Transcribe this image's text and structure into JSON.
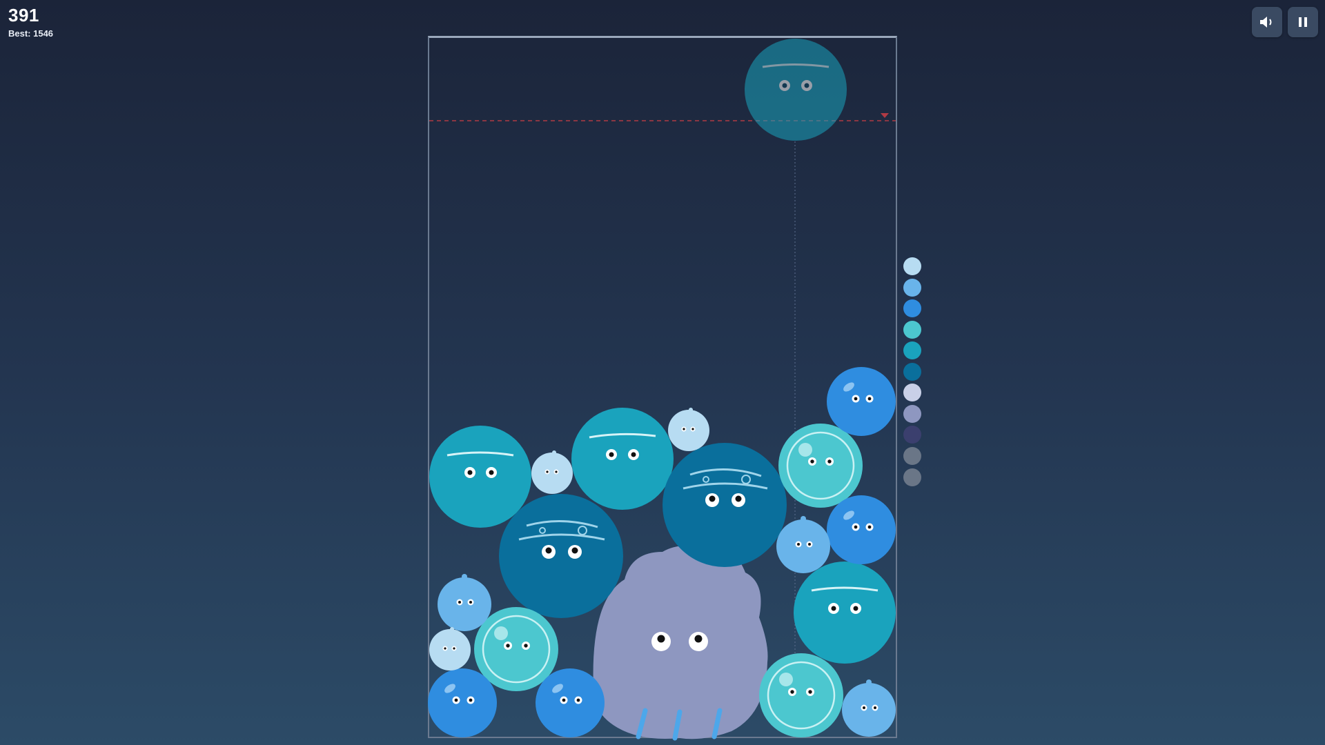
{
  "hud": {
    "score": "391",
    "best": "Best: 1546"
  },
  "controls": {
    "sound_icon": "speaker-icon",
    "pause_icon": "pause-icon"
  },
  "colors": {
    "tier1": "#b7dcf2",
    "tier2": "#69b4ea",
    "tier3": "#2f8de0",
    "tier4": "#4cc7cf",
    "tier5": "#1aa3bd",
    "tier6": "#0a6f9c",
    "tier7": "#c9d0e8",
    "tier8": "#8e97c0",
    "tier9": "#3b3f6e",
    "locked": "#6a7687",
    "danger_line": "#b03a44"
  },
  "legend": [
    "tier1",
    "tier2",
    "tier3",
    "tier4",
    "tier5",
    "tier6",
    "tier7",
    "tier8",
    "tier9",
    "locked",
    "locked"
  ]
}
